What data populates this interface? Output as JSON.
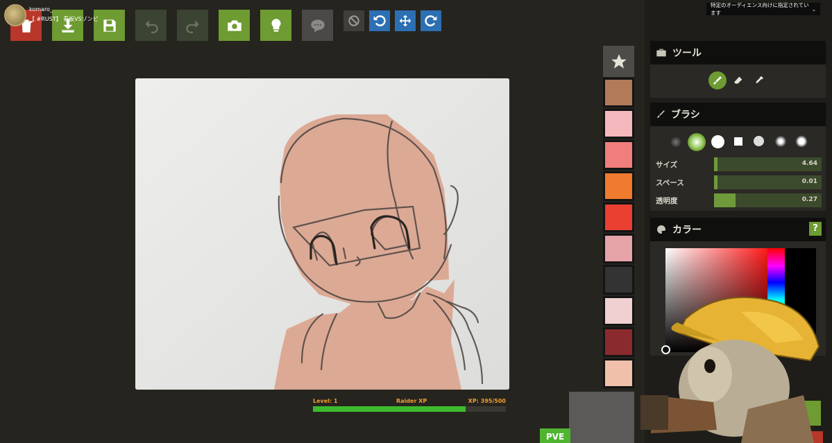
{
  "channel": {
    "name": "komaro_",
    "stream_title": "【 #RUST】 看板VSゾンビ"
  },
  "toolbar": {
    "buttons": [
      {
        "id": "delete",
        "icon": "trash-icon",
        "color": "#b9372a"
      },
      {
        "id": "download",
        "icon": "download-icon",
        "color": "#6e9b32"
      },
      {
        "id": "save",
        "icon": "save-icon",
        "color": "#6e9b32"
      },
      {
        "id": "undo",
        "icon": "undo-icon",
        "color": "#3b4432"
      },
      {
        "id": "redo",
        "icon": "redo-icon",
        "color": "#3b4432"
      },
      {
        "id": "camera",
        "icon": "camera-icon",
        "color": "#6e9b32"
      },
      {
        "id": "hint",
        "icon": "lightbulb-icon",
        "color": "#6e9b32"
      },
      {
        "id": "chat",
        "icon": "chat-bubble-icon",
        "color": "#4a4947"
      }
    ],
    "small_buttons": [
      {
        "id": "block",
        "icon": "prohibit-icon",
        "color": "#3f3e3b"
      },
      {
        "id": "rotate-left",
        "icon": "rotate-left-icon",
        "color": "#2d6fb3"
      },
      {
        "id": "move",
        "icon": "move-icon",
        "color": "#2d6fb3"
      },
      {
        "id": "rotate-right",
        "icon": "rotate-right-icon",
        "color": "#2d6fb3"
      }
    ]
  },
  "palette": {
    "swatches": [
      "#b27a58",
      "#f5b8bc",
      "#f07e7c",
      "#f07a2e",
      "#e94032",
      "#e6a4a8",
      "#333333",
      "#f0d0d0",
      "#8b2a2e",
      "#f0c0aa"
    ]
  },
  "xp": {
    "level": "Level: 1",
    "label": "Raider XP",
    "value": "XP: 395/500",
    "progress": 0.79
  },
  "pve": "PVE",
  "audience": {
    "label": "特定のオーディエンス向けに指定されています"
  },
  "panel": {
    "tools": {
      "title": "ツール",
      "items": [
        "brush-tool-icon",
        "eraser-tool-icon",
        "eyedropper-tool-icon"
      ]
    },
    "brush": {
      "title": "ブラシ",
      "tips": [
        "soft-round-tip",
        "glow-round-tip",
        "hard-round-tip",
        "square-tip",
        "rough-round-tip",
        "splatter-tip",
        "burst-tip"
      ],
      "sliders": [
        {
          "label": "サイズ",
          "value": "4.64",
          "fraction": 0.03
        },
        {
          "label": "スペース",
          "value": "0.01",
          "fraction": 0.01
        },
        {
          "label": "透明度",
          "value": "0.27",
          "fraction": 0.2
        }
      ]
    },
    "color": {
      "title": "カラー",
      "hue_overlay_value": "0"
    }
  },
  "colors": {
    "accent_green": "#6e9b32",
    "danger_red": "#b9372a",
    "action_blue": "#2d6fb3"
  }
}
